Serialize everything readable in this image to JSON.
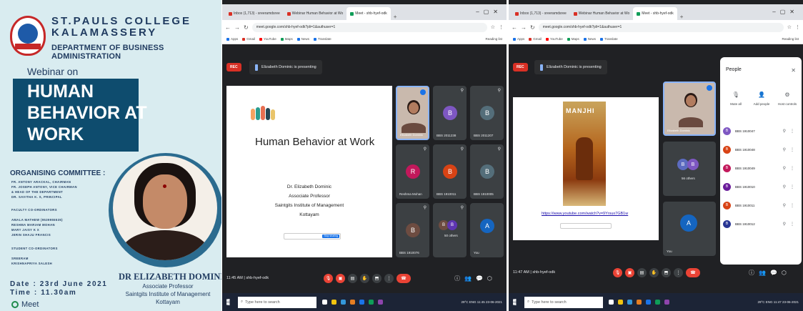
{
  "poster": {
    "college_line1": "ST.PAULS COLLEGE",
    "college_line2": "KALAMASSERY",
    "department": "DEPARTMENT OF BUSINESS ADMINISTRATION",
    "webinar_on": "Webinar on",
    "title_line1": "HUMAN",
    "title_line2": "BEHAVIOR AT",
    "title_line3": "WORK",
    "committee_title": "ORGANISING COMMITTEE :",
    "committee": [
      "FR. ANTONY ARACKAL, CHAIRMAN",
      "FR. JOSEPH ANTONY, VICE CHAIRMAN",
      "& HEAD OF THE DEPARTMENT",
      "DR. SAVITHA K. S, PRINCIPAL"
    ],
    "faculty_title": "FACULTY CO-ORDINATORS",
    "faculty": [
      "AMALA MATHEW (9539955535)",
      "RESHMA MARIAM MOHAN",
      "MARY JAISY K X",
      "JERIN SHAJU FRANCIS"
    ],
    "student_title": "STUDENT CO-ORDINATORS",
    "students": [
      "SREERAM",
      "KRISHNAPRIYA SALESH"
    ],
    "date": "Date : 23rd June 2021",
    "time": "Time : 11.30am",
    "speaker_name": "DR ELIZABETH DOMINIC",
    "speaker_role": "Associate Professor",
    "speaker_org": "Saintgits Institute of Management",
    "speaker_city": "Kottayam",
    "meet_label": "Meet"
  },
  "shot1": {
    "tabs": [
      "Inbox (1,713) - sreeramdsree",
      "Webinar Human Behavior at Wo",
      "Meet - shb-hyef-odk"
    ],
    "url": "meet.google.com/shb-hyef-odk?pli=1&authuser=1",
    "bookmarks": [
      "Apps",
      "Gmail",
      "YouTube",
      "Maps",
      "News",
      "Translate"
    ],
    "bookmarks_right": "Reading list",
    "rec": "REC",
    "presenting": "Elizabeth Dominic is presenting",
    "slide_title": "Human Behavior at Work",
    "slide_lines": [
      "Dr. Elizabeth Dominic",
      "Associate Professor",
      "Saintgits Institute of Management",
      "Kottayam"
    ],
    "slide_button": "Stop sharing",
    "tiles": [
      {
        "initial": "",
        "name": "Elizabeth Dominic"
      },
      {
        "initial": "B",
        "name": "BBS 2011238",
        "color": "#7e57c2"
      },
      {
        "initial": "B",
        "name": "BBS 2011207",
        "color": "#546e7a"
      },
      {
        "initial": "R",
        "name": "Reshma Mohan",
        "color": "#c2185b"
      },
      {
        "initial": "B",
        "name": "BBS 1910011",
        "color": "#d84315"
      },
      {
        "initial": "B",
        "name": "BBS 1910005",
        "color": "#546e7a"
      },
      {
        "initial": "B",
        "name": "BBS 1910076",
        "color": "#6d4c41"
      },
      {
        "initial": "",
        "name": "50 others"
      },
      {
        "initial": "A",
        "name": "You",
        "color": "#1565c0"
      }
    ],
    "clock": "11:45 AM | shb-hyef-odk",
    "taskbar_search": "Type here to search",
    "tray": "29°C ENG 11:45 23-06-2021"
  },
  "shot2": {
    "tabs": [
      "Inbox (1,713) - sreeramdsree",
      "Webinar Human Behavior at Wo",
      "Meet - shb-hyef-odk"
    ],
    "url": "meet.google.com/shb-hyef-odk?pli=1&authuser=1",
    "bookmarks": [
      "Apps",
      "Gmail",
      "YouTube",
      "Maps",
      "News",
      "Translate"
    ],
    "bookmarks_right": "Reading list",
    "rec": "REC",
    "presenting": "Elizabeth Dominic is presenting",
    "slide_link": "https://www.youtube.com/watch?v=9Yrsux7GB1w",
    "poster_title": "MANJHI",
    "self_name": "Elizabeth Dominic",
    "others": "56 others",
    "you": "You",
    "people_title": "People",
    "actions": [
      "Mute all",
      "Add people",
      "Host controls"
    ],
    "participants": [
      {
        "name": "BBS 1910047",
        "color": "#7e57c2"
      },
      {
        "name": "BBS 1910048",
        "color": "#d84315"
      },
      {
        "name": "BBS 1910049",
        "color": "#c2185b"
      },
      {
        "name": "BBS 1910010",
        "color": "#6a1b9a"
      },
      {
        "name": "BBS 1910011",
        "color": "#d84315"
      },
      {
        "name": "BBS 1910012",
        "color": "#283593"
      }
    ],
    "clock": "11:47 AM | shb-hyef-odk",
    "taskbar_search": "Type here to search",
    "tray": "29°C ENG 11:47 23-06-2021"
  }
}
